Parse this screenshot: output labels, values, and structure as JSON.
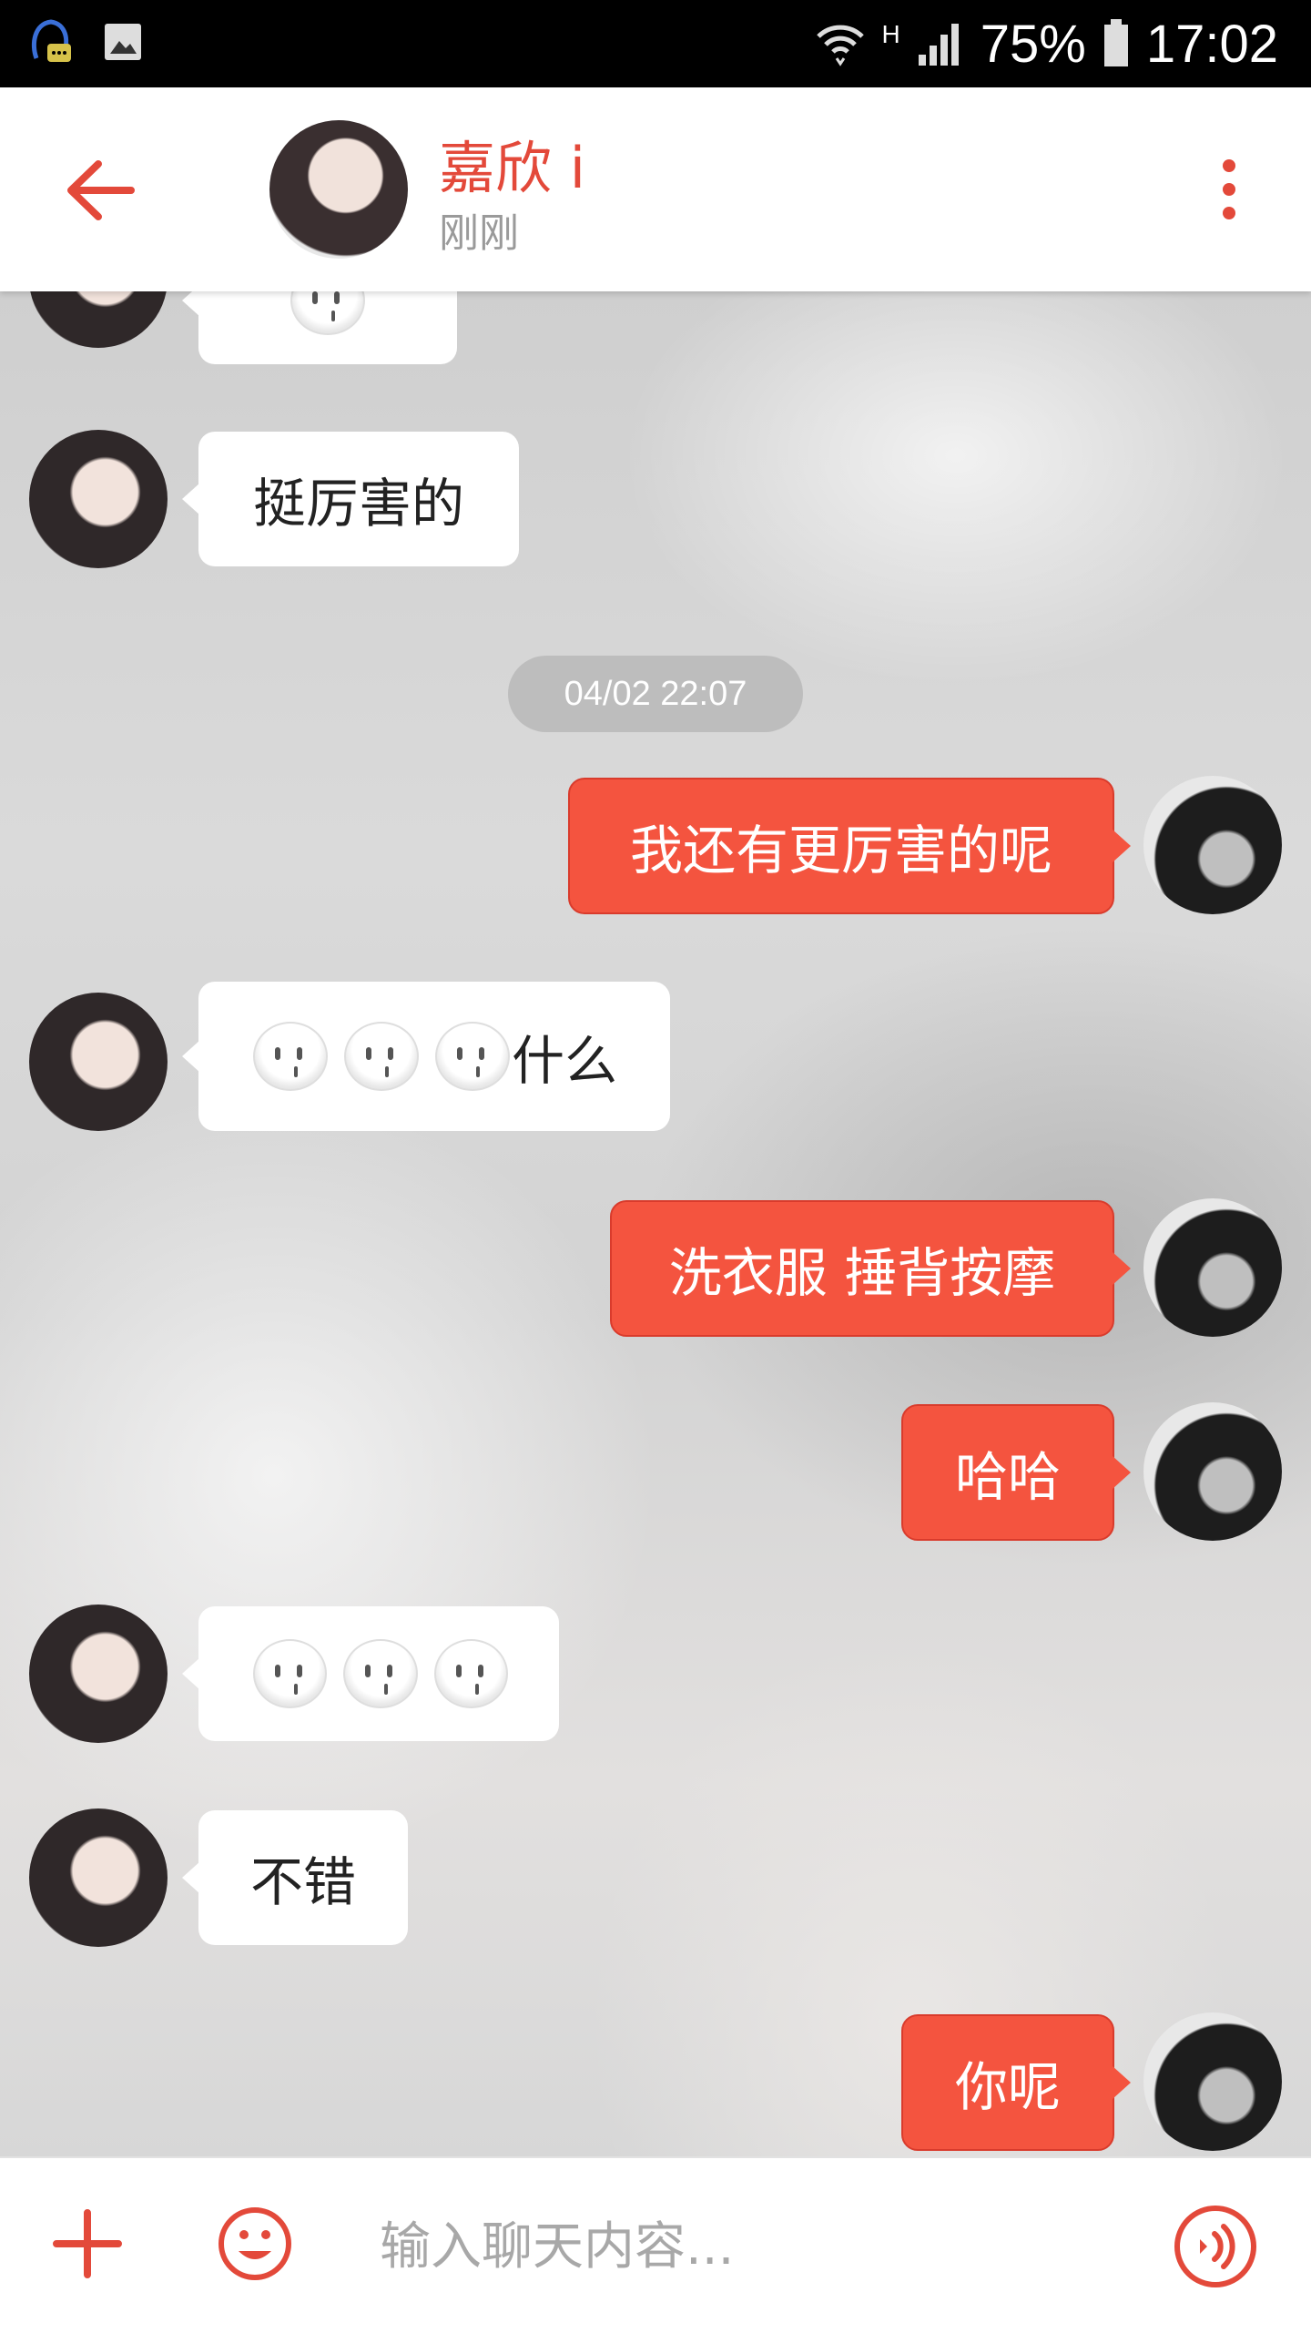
{
  "status_bar": {
    "signal_mode": "H",
    "battery": "75%",
    "time": "17:02"
  },
  "header": {
    "title": "嘉欣 i",
    "subtitle": "刚刚"
  },
  "chat": {
    "timestamp": "04/02 22:07",
    "messages": [
      {
        "from": "her",
        "text": "",
        "emoji_count": 1,
        "partial": true
      },
      {
        "from": "her",
        "text": "挺厉害的"
      },
      {
        "from": "me",
        "text": "我还有更厉害的呢"
      },
      {
        "from": "her",
        "text": "什么",
        "emoji_count": 3
      },
      {
        "from": "me",
        "text": "洗衣服 捶背按摩"
      },
      {
        "from": "me",
        "text": "哈哈"
      },
      {
        "from": "her",
        "text": "",
        "emoji_count": 3
      },
      {
        "from": "her",
        "text": "不错"
      },
      {
        "from": "me",
        "text": "你呢"
      }
    ]
  },
  "input_bar": {
    "placeholder": "输入聊天内容..."
  },
  "colors": {
    "accent": "#e3493a",
    "bubble_out": "#f4543f"
  }
}
